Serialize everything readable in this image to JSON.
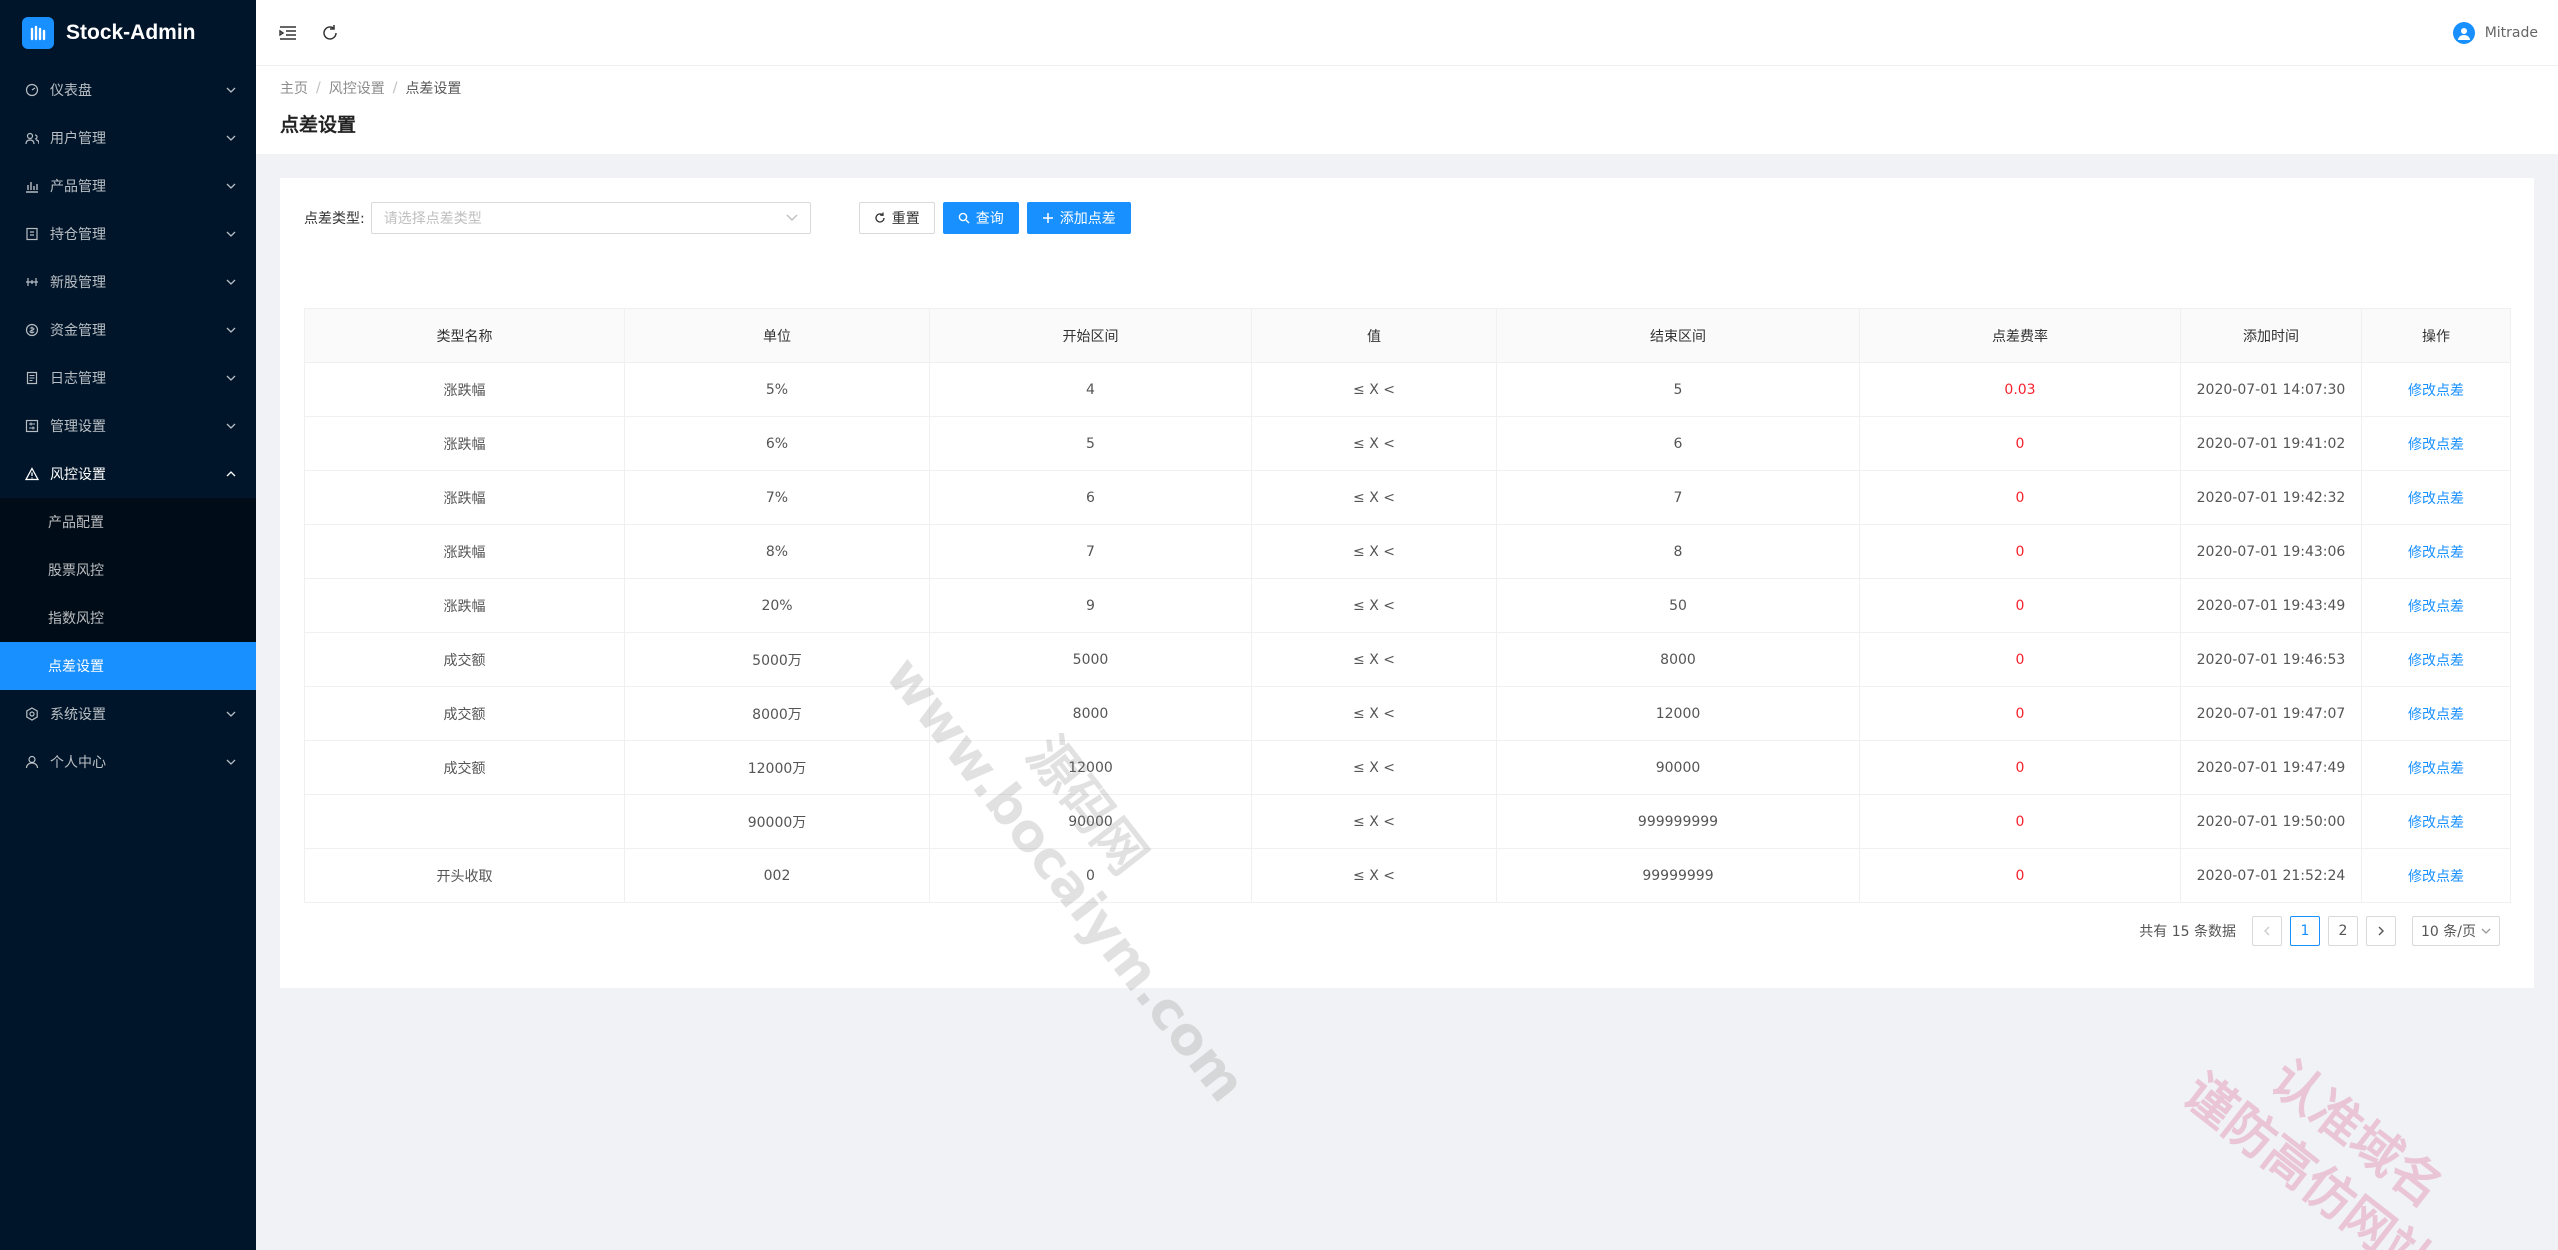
{
  "app": {
    "title": "Stock-Admin"
  },
  "sidebar": {
    "items": [
      {
        "label": "仪表盘",
        "icon": "dashboard-icon"
      },
      {
        "label": "用户管理",
        "icon": "users-icon"
      },
      {
        "label": "产品管理",
        "icon": "bar-chart-icon"
      },
      {
        "label": "持仓管理",
        "icon": "position-icon"
      },
      {
        "label": "新股管理",
        "icon": "ipo-icon"
      },
      {
        "label": "资金管理",
        "icon": "money-icon"
      },
      {
        "label": "日志管理",
        "icon": "log-icon"
      },
      {
        "label": "管理设置",
        "icon": "admin-settings-icon"
      },
      {
        "label": "风控设置",
        "icon": "warning-icon",
        "open": true
      },
      {
        "label": "系统设置",
        "icon": "system-settings-icon"
      },
      {
        "label": "个人中心",
        "icon": "user-icon"
      }
    ],
    "submenu": [
      {
        "label": "产品配置"
      },
      {
        "label": "股票风控"
      },
      {
        "label": "指数风控"
      },
      {
        "label": "点差设置",
        "active": true
      }
    ]
  },
  "header": {
    "user_name": "Mitrade"
  },
  "breadcrumb": [
    "主页",
    "风控设置",
    "点差设置"
  ],
  "page": {
    "title": "点差设置"
  },
  "filter": {
    "label": "点差类型:",
    "placeholder": "请选择点差类型",
    "reset_label": "重置",
    "query_label": "查询",
    "add_label": "添加点差"
  },
  "table": {
    "columns": [
      "类型名称",
      "单位",
      "开始区间",
      "值",
      "结束区间",
      "点差费率",
      "添加时间",
      "操作"
    ],
    "rows": [
      [
        "涨跌幅",
        "5%",
        "4",
        "≤ X <",
        "5",
        "0.03",
        "2020-07-01 14:07:30",
        "修改点差"
      ],
      [
        "涨跌幅",
        "6%",
        "5",
        "≤ X <",
        "6",
        "0",
        "2020-07-01 19:41:02",
        "修改点差"
      ],
      [
        "涨跌幅",
        "7%",
        "6",
        "≤ X <",
        "7",
        "0",
        "2020-07-01 19:42:32",
        "修改点差"
      ],
      [
        "涨跌幅",
        "8%",
        "7",
        "≤ X <",
        "8",
        "0",
        "2020-07-01 19:43:06",
        "修改点差"
      ],
      [
        "涨跌幅",
        "20%",
        "9",
        "≤ X <",
        "50",
        "0",
        "2020-07-01 19:43:49",
        "修改点差"
      ],
      [
        "成交额",
        "5000万",
        "5000",
        "≤ X <",
        "8000",
        "0",
        "2020-07-01 19:46:53",
        "修改点差"
      ],
      [
        "成交额",
        "8000万",
        "8000",
        "≤ X <",
        "12000",
        "0",
        "2020-07-01 19:47:07",
        "修改点差"
      ],
      [
        "成交额",
        "12000万",
        "12000",
        "≤ X <",
        "90000",
        "0",
        "2020-07-01 19:47:49",
        "修改点差"
      ],
      [
        "",
        "90000万",
        "90000",
        "≤ X <",
        "999999999",
        "0",
        "2020-07-01 19:50:00",
        "修改点差"
      ],
      [
        "开头收取",
        "002",
        "0",
        "≤ X <",
        "99999999",
        "0",
        "2020-07-01 21:52:24",
        "修改点差"
      ]
    ]
  },
  "pagination": {
    "total_text": "共有 15 条数据",
    "pages": [
      "1",
      "2"
    ],
    "current": "1",
    "page_size": "10 条/页"
  },
  "watermarks": {
    "center_line1": "源码网",
    "center_line2": "www.bocaiym.com",
    "corner_line1": "认准域名",
    "corner_line2": "谨防高仿网站"
  },
  "colors": {
    "accent": "#1890ff",
    "sidebar_bg": "#001529",
    "danger": "#f5222d"
  }
}
